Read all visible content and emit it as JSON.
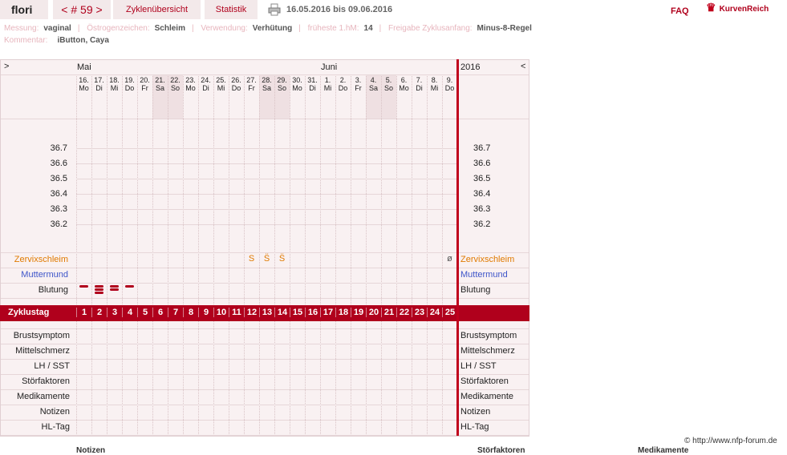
{
  "header": {
    "user": "flori",
    "cycle_nav": "< # 59 >",
    "tab_overview": "Zyklenübersicht",
    "tab_stats": "Statistik",
    "date_range": "16.05.2016 bis 09.06.2016",
    "faq": "FAQ",
    "logo": "KurvenReich"
  },
  "info": {
    "messung_label": "Messung:",
    "messung": "vaginal",
    "oestrogen_label": "Östrogenzeichen:",
    "oestrogen": "Schleim",
    "verwendung_label": "Verwendung:",
    "verwendung": "Verhütung",
    "hm_label": "früheste 1.hM:",
    "hm": "14",
    "freigabe_label": "Freigabe Zyklusanfang:",
    "freigabe": "Minus-8-Regel",
    "kommentar_label": "Kommentar:",
    "kommentar": "iButton, Caya"
  },
  "chart": {
    "nav_left": ">",
    "nav_right": "<",
    "year": "2016",
    "months": [
      {
        "name": "Mai"
      },
      {
        "name": "Juni"
      }
    ],
    "days": [
      {
        "d": "16.",
        "w": "Mo",
        "we": false
      },
      {
        "d": "17.",
        "w": "Di",
        "we": false
      },
      {
        "d": "18.",
        "w": "Mi",
        "we": false
      },
      {
        "d": "19.",
        "w": "Do",
        "we": false
      },
      {
        "d": "20.",
        "w": "Fr",
        "we": false
      },
      {
        "d": "21.",
        "w": "Sa",
        "we": true
      },
      {
        "d": "22.",
        "w": "So",
        "we": true
      },
      {
        "d": "23.",
        "w": "Mo",
        "we": false
      },
      {
        "d": "24.",
        "w": "Di",
        "we": false
      },
      {
        "d": "25.",
        "w": "Mi",
        "we": false
      },
      {
        "d": "26.",
        "w": "Do",
        "we": false
      },
      {
        "d": "27.",
        "w": "Fr",
        "we": false
      },
      {
        "d": "28.",
        "w": "Sa",
        "we": true
      },
      {
        "d": "29.",
        "w": "So",
        "we": true
      },
      {
        "d": "30.",
        "w": "Mo",
        "we": false
      },
      {
        "d": "31.",
        "w": "Di",
        "we": false
      },
      {
        "d": "1.",
        "w": "Mi",
        "we": false
      },
      {
        "d": "2.",
        "w": "Do",
        "we": false
      },
      {
        "d": "3.",
        "w": "Fr",
        "we": false
      },
      {
        "d": "4.",
        "w": "Sa",
        "we": true
      },
      {
        "d": "5.",
        "w": "So",
        "we": true
      },
      {
        "d": "6.",
        "w": "Mo",
        "we": false
      },
      {
        "d": "7.",
        "w": "Di",
        "we": false
      },
      {
        "d": "8.",
        "w": "Mi",
        "we": false
      },
      {
        "d": "9.",
        "w": "Do",
        "we": false
      }
    ],
    "temps": [
      "36.7",
      "36.6",
      "36.5",
      "36.4",
      "36.3",
      "36.2"
    ],
    "rows_top": [
      "Zervixschleim",
      "Muttermund",
      "Blutung"
    ],
    "zyklustag_label": "Zyklustag",
    "rows_bottom": [
      "Brustsymptom",
      "Mittelschmerz",
      "LH / SST",
      "Störfaktoren",
      "Medikamente",
      "Notizen",
      "HL-Tag"
    ],
    "cervix_marks": [
      {
        "day": 12,
        "s": "S"
      },
      {
        "day": 13,
        "s": "S̈"
      },
      {
        "day": 14,
        "s": "S̈"
      },
      {
        "day": 25,
        "s": "ø"
      }
    ],
    "bleeding": [
      {
        "day": 1,
        "n": 1
      },
      {
        "day": 2,
        "n": 3
      },
      {
        "day": 3,
        "n": 2
      },
      {
        "day": 4,
        "n": 1
      }
    ],
    "colors": {
      "accent": "#b0001c",
      "weekend": "#efe0e2",
      "grid": "#e6d6d8",
      "red_line": "#c0001c"
    }
  },
  "footer": {
    "notizen": "Notizen",
    "stoerfaktoren": "Störfaktoren",
    "medikamente": "Medikamente",
    "copyright": "© http://www.nfp-forum.de"
  }
}
